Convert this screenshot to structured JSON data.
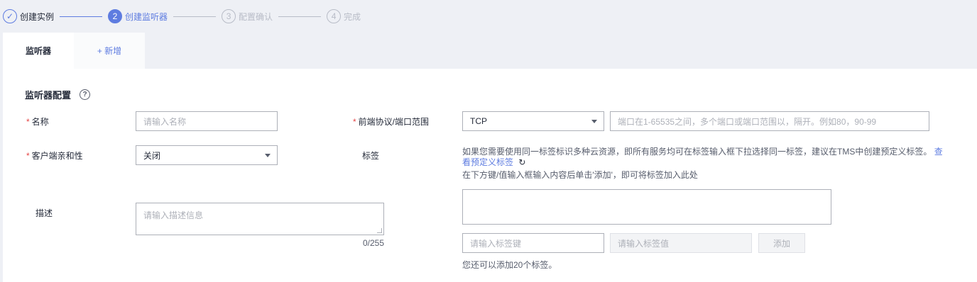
{
  "steps": [
    {
      "label": "创建实例",
      "num": "✓"
    },
    {
      "label": "创建监听器",
      "num": "2"
    },
    {
      "label": "配置确认",
      "num": "3"
    },
    {
      "label": "完成",
      "num": "4"
    }
  ],
  "tabs": {
    "listener": "监听器",
    "add": "+ 新增"
  },
  "section": {
    "title": "监听器配置",
    "help": "?"
  },
  "form": {
    "name_label": "名称",
    "name_placeholder": "请输入名称",
    "protocol_label": "前端协议/端口范围",
    "protocol_value": "TCP",
    "port_placeholder": "端口在1-65535之间，多个端口或端口范围以，隔开。例如80，90-99",
    "affinity_label": "客户端亲和性",
    "affinity_value": "关闭",
    "tags_label": "标签",
    "desc_label": "描述",
    "desc_placeholder": "请输入描述信息",
    "desc_counter": "0/255",
    "required_mark": "*"
  },
  "tags": {
    "hint_line1": "如果您需要使用同一标签标识多种云资源，即所有服务均可在标签输入框下拉选择同一标签，建议在TMS中创建预定义标签。",
    "link_part1": "查",
    "link_part2": "看预定义标签",
    "hint_line2": "在下方键/值输入框输入内容后单击'添加'，即可将标签加入此处",
    "key_placeholder": "请输入标签键",
    "value_placeholder": "请输入标签值",
    "add_button": "添加",
    "remaining": "您还可以添加20个标签。"
  }
}
